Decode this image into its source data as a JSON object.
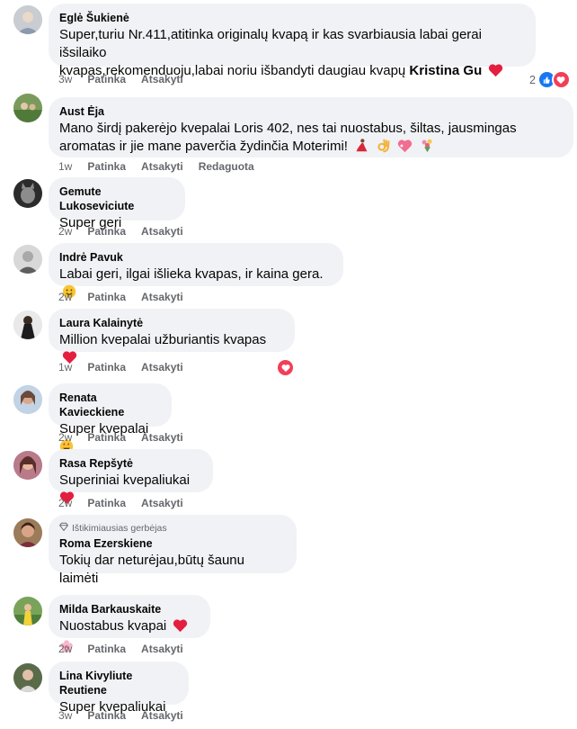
{
  "actions": {
    "like": "Patinka",
    "reply": "Atsakyti",
    "edited": "Redaguota"
  },
  "comments": [
    {
      "name": "Eglė Šukienė",
      "text_lines": [
        "Super,turiu Nr.411,atitinka originalų kvapą ir kas svarbiausia labai gerai išsilaiko",
        "kvapas,rekomenduoju,labai noriu išbandyti daugiau kvapų "
      ],
      "tag": "Kristina Gu",
      "time": "3w",
      "reaction_count": "2"
    },
    {
      "name": "Aust Ėja",
      "text_lines": [
        "Mano širdį pakerėjo kvepalai Loris 402, nes tai nuostabus, šiltas, jausmingas",
        "aromatas ir jie mane paverčia žydinčia Moterimi! "
      ],
      "time": "1w"
    },
    {
      "name": "Gemute Lukoseviciute",
      "text": "Super geri",
      "time": "2w"
    },
    {
      "name": "Indrė Pavuk",
      "text": "Labai geri, ilgai išlieka kvapas, ir kaina gera. ",
      "time": "2w"
    },
    {
      "name": "Laura Kalainytė",
      "text": "Million kvepalai užburiantis kvapas ",
      "time": "1w"
    },
    {
      "name": "Renata Kavieckiene",
      "text": "Super kvepalai",
      "time": "2w"
    },
    {
      "name": "Rasa Repšytė",
      "text": "Superiniai kvepaliukai",
      "time": "2w"
    },
    {
      "name": "Roma Ezerskiene",
      "badge": "Ištikimiausias gerbėjas",
      "text": "Tokių dar neturėjau,būtų šaunu laimėti",
      "time": "2w"
    },
    {
      "name": "Milda Barkauskaite",
      "text": "Nuostabus kvapai ",
      "time": "2w"
    },
    {
      "name": "Lina Kivyliute Reutiene",
      "text": "Super kvepaliukai",
      "time": "3w"
    }
  ],
  "colors": {
    "bubble": "#f0f2f5",
    "meta": "#65676b",
    "like_blue": "#1877f2",
    "heart_red": "#f33e58"
  }
}
